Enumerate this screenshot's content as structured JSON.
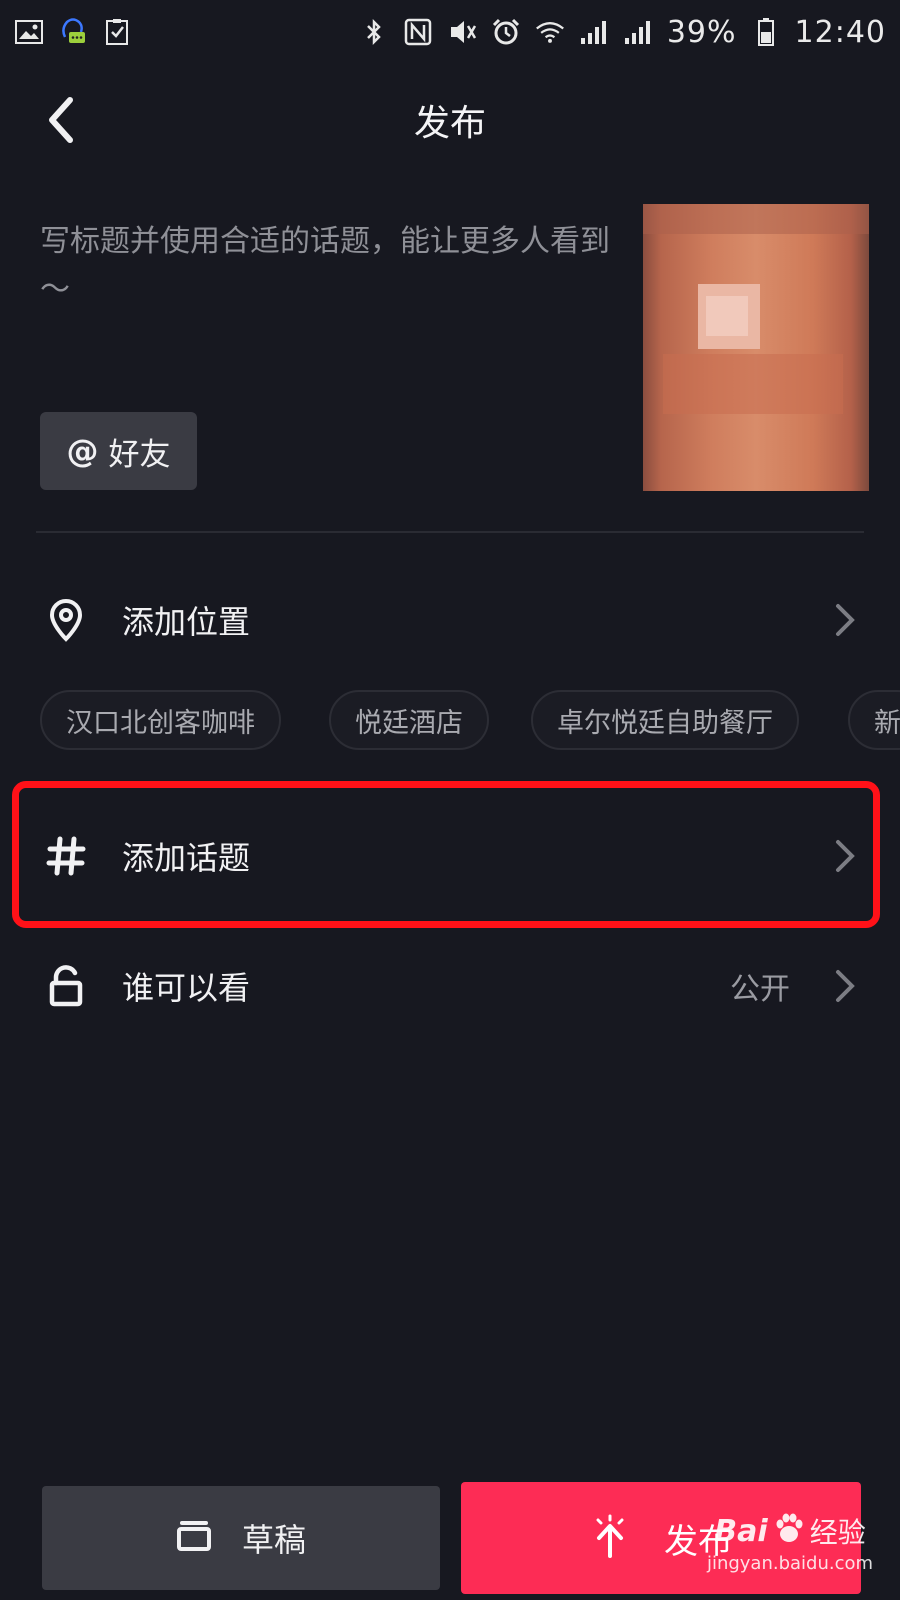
{
  "status_bar": {
    "battery_percent": "39%",
    "time": "12:40",
    "left_icons": [
      "gallery-notification-icon",
      "chat-notification-icon",
      "task-notification-icon"
    ],
    "right_icons": [
      "bluetooth-icon",
      "nfc-icon",
      "vibrate-icon",
      "alarm-icon",
      "wifi-icon",
      "signal-icon",
      "signal-4g-icon",
      "battery-icon"
    ]
  },
  "nav": {
    "title": "发布",
    "back_icon": "chevron-left-icon"
  },
  "caption": {
    "placeholder": "写标题并使用合适的话题，能让更多人看到～"
  },
  "mention": {
    "at_symbol": "@",
    "label": "好友"
  },
  "location": {
    "label": "添加位置",
    "icon": "location-pin-icon",
    "suggestions": [
      "汉口北创客咖啡",
      "悦廷酒店",
      "卓尔悦廷自助餐厅",
      "新"
    ]
  },
  "topic": {
    "label": "添加话题",
    "icon": "hashtag-icon"
  },
  "visibility": {
    "label": "谁可以看",
    "value": "公开",
    "icon": "unlock-icon"
  },
  "actions": {
    "draft_label": "草稿",
    "publish_label": "发布"
  },
  "watermark": {
    "brand": "Bai",
    "brand2": "经验",
    "url": "jingyan.baidu.com"
  },
  "colors": {
    "background": "#171820",
    "publish_button": "#fd2c55",
    "draft_button": "#3a3b43",
    "highlight_border": "#ff1118"
  }
}
